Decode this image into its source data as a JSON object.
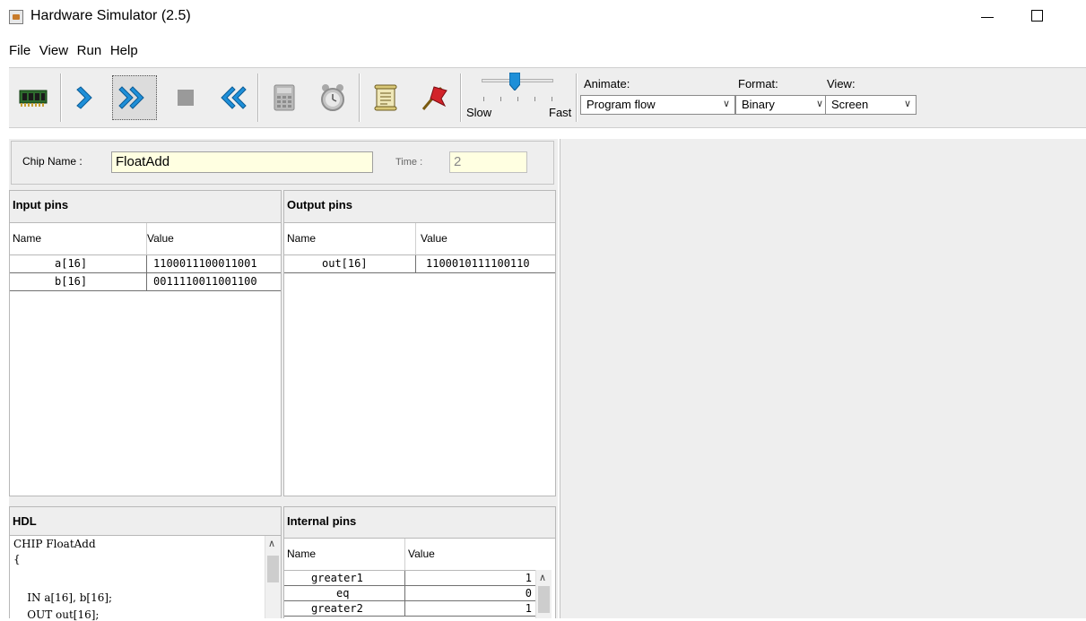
{
  "window": {
    "title": "Hardware Simulator (2.5)"
  },
  "menu": [
    "File",
    "View",
    "Run",
    "Help"
  ],
  "toolbar": {
    "buttons": [
      {
        "name": "load-chip-icon"
      },
      {
        "name": "single-step-icon"
      },
      {
        "name": "run-icon"
      },
      {
        "name": "stop-icon"
      },
      {
        "name": "reset-icon"
      },
      {
        "name": "eval-calculator-icon"
      },
      {
        "name": "clock-icon"
      },
      {
        "name": "load-script-icon"
      },
      {
        "name": "breakpoints-flag-icon"
      }
    ],
    "speed": {
      "slow_label": "Slow",
      "fast_label": "Fast",
      "level": 0.6
    },
    "animate": {
      "label": "Animate:",
      "value": "Program flow"
    },
    "format": {
      "label": "Format:",
      "value": "Binary"
    },
    "view": {
      "label": "View:",
      "value": "Screen"
    }
  },
  "chip": {
    "name_label": "Chip Name :",
    "name_value": "FloatAdd",
    "time_label": "Time :",
    "time_value": "2"
  },
  "input_pins": {
    "title": "Input pins",
    "columns": [
      "Name",
      "Value"
    ],
    "rows": [
      {
        "name": "a[16]",
        "value": "1100011100011001"
      },
      {
        "name": "b[16]",
        "value": "0011110011001100"
      }
    ]
  },
  "output_pins": {
    "title": "Output pins",
    "columns": [
      "Name",
      "Value"
    ],
    "rows": [
      {
        "name": "out[16]",
        "value": "1100010111100110"
      }
    ]
  },
  "hdl": {
    "title": "HDL",
    "lines": [
      "CHIP FloatAdd",
      "{",
      "",
      "    IN a[16], b[16];",
      "    OUT out[16];"
    ]
  },
  "internal_pins": {
    "title": "Internal pins",
    "columns": [
      "Name",
      "Value"
    ],
    "rows": [
      {
        "name": "greater1",
        "value": "1"
      },
      {
        "name": "eq",
        "value": "0"
      },
      {
        "name": "greater2",
        "value": "1"
      }
    ]
  },
  "colors": {
    "yellow_field": "#ffffe1",
    "panel_bg": "#eeeeee",
    "accent_blue": "#1e8fd8"
  }
}
